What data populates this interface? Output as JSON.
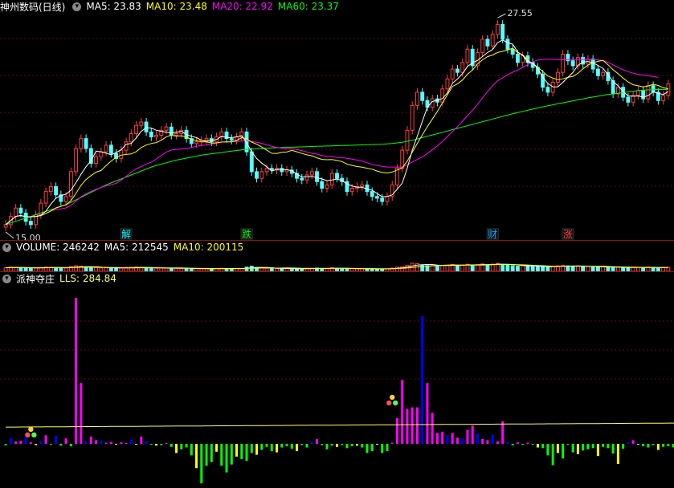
{
  "price_panel": {
    "name": "神州数码(日线)",
    "ma5": "MA5: 23.83",
    "ma10": "MA10: 23.48",
    "ma20": "MA20: 22.92",
    "ma60": "MA60: 23.37",
    "colors": {
      "name": "#ffffff",
      "ma5": "#ffffff",
      "ma10": "#ffff00",
      "ma20": "#ff00ff",
      "ma60": "#00ff00"
    }
  },
  "volume_panel": {
    "label": "VOLUME: 246242",
    "ma5": "MA5: 212545",
    "ma10": "MA10: 200115"
  },
  "indicator_panel": {
    "name": "派神夺庄",
    "lls": "LLS: 284.84"
  },
  "events": [
    {
      "label": "解",
      "index": 24,
      "color": "#00ffff"
    },
    {
      "label": "跌",
      "index": 48,
      "color": "#00ff00"
    },
    {
      "label": "财",
      "index": 97,
      "color": "#00aaff"
    },
    {
      "label": "涨",
      "index": 112,
      "color": "#ff4040"
    }
  ],
  "chart_data": [
    {
      "type": "candlestick",
      "title": "神州数码(日线)",
      "ylim": [
        15.0,
        27.9
      ],
      "high_annotation": "27.55",
      "low_annotation": "15.00",
      "closes": [
        15.2,
        15.7,
        16.2,
        15.9,
        15.4,
        15.2,
        15.8,
        16.5,
        17.2,
        17.5,
        17.0,
        16.6,
        16.9,
        18.4,
        19.8,
        20.4,
        19.8,
        18.9,
        19.3,
        19.6,
        20.0,
        19.5,
        19.2,
        19.7,
        20.2,
        20.7,
        21.2,
        21.4,
        20.8,
        20.5,
        20.6,
        20.9,
        21.1,
        20.6,
        20.7,
        20.9,
        20.4,
        20.1,
        20.2,
        20.3,
        20.4,
        20.2,
        20.5,
        20.8,
        20.4,
        20.3,
        20.5,
        20.8,
        19.6,
        18.4,
        18.0,
        18.4,
        18.6,
        18.5,
        18.6,
        18.4,
        18.5,
        18.3,
        18.0,
        17.9,
        18.2,
        18.4,
        17.8,
        17.4,
        17.6,
        18.3,
        18.0,
        17.8,
        17.2,
        17.4,
        17.5,
        17.6,
        17.2,
        16.9,
        16.8,
        16.6,
        16.9,
        17.6,
        18.6,
        19.7,
        20.9,
        22.4,
        23.2,
        22.7,
        22.3,
        22.8,
        22.6,
        23.4,
        24.0,
        24.6,
        24.4,
        25.0,
        25.8,
        24.8,
        25.6,
        26.4,
        26.0,
        26.7,
        27.3,
        26.4,
        25.8,
        25.5,
        25.0,
        25.4,
        25.0,
        24.7,
        24.3,
        23.5,
        23.2,
        23.8,
        24.4,
        25.5,
        25.1,
        24.8,
        25.3,
        24.9,
        25.2,
        24.6,
        24.2,
        24.4,
        23.9,
        23.1,
        23.5,
        22.9,
        22.6,
        23.0,
        23.3,
        22.8,
        23.6,
        23.2,
        22.7,
        23.0,
        23.7
      ],
      "ma5": [
        15.2,
        15.45,
        15.7,
        15.75,
        15.68,
        15.68,
        15.7,
        15.76,
        16.02,
        16.44,
        16.8,
        16.96,
        17.04,
        17.28,
        17.74,
        18.24,
        18.7,
        19.06,
        19.64,
        19.6,
        19.52,
        19.42,
        19.56,
        19.72,
        20.06,
        20.1,
        20.44,
        20.84,
        21.06,
        21.04,
        20.9,
        20.84,
        20.78,
        20.74,
        20.78,
        20.84,
        20.64,
        20.54,
        20.46,
        20.3,
        20.24,
        20.28,
        20.34,
        20.54,
        20.46,
        20.46,
        20.5,
        20.58,
        20.16,
        19.6,
        19.2,
        18.92,
        18.7,
        18.44,
        18.54,
        18.54,
        18.52,
        18.46,
        18.26,
        18.08,
        18.1,
        18.12,
        18.04,
        17.96,
        17.86,
        17.9,
        17.96,
        17.86,
        17.66,
        17.54,
        17.46,
        17.46,
        17.34,
        17.28,
        17.08,
        16.88,
        16.9,
        17.0,
        17.34,
        17.7,
        18.62,
        19.7,
        20.56,
        21.44,
        22.3,
        22.64,
        22.72,
        22.82,
        23.16,
        23.74,
        24.0,
        24.32,
        24.76,
        24.98,
        25.12,
        25.36,
        25.6,
        25.78,
        26.2,
        26.36,
        26.2,
        26.1,
        25.64,
        25.42,
        25.02,
        24.96,
        24.64,
        24.1,
        23.74,
        23.52,
        23.52,
        23.8,
        24.1,
        24.4,
        24.82,
        25.02,
        25.06,
        24.98,
        24.82,
        24.64,
        24.26,
        23.84,
        23.6,
        23.24,
        22.98,
        22.96,
        22.98,
        22.9,
        23.0,
        23.22,
        23.14,
        23.06,
        23.24
      ],
      "ma10": [
        15.2,
        15.45,
        15.7,
        15.75,
        15.68,
        15.67,
        15.69,
        15.74,
        15.88,
        16.03,
        16.21,
        16.31,
        16.4,
        16.65,
        17.09,
        17.57,
        17.93,
        18.16,
        18.37,
        18.47,
        18.77,
        19.04,
        19.27,
        19.4,
        19.44,
        19.47,
        19.61,
        19.86,
        20.01,
        20.1,
        20.16,
        20.3,
        20.51,
        20.6,
        20.55,
        20.57,
        20.49,
        20.36,
        20.27,
        20.21,
        20.2,
        20.13,
        20.14,
        20.19,
        20.2,
        20.2,
        20.28,
        20.46,
        20.39,
        20.19,
        20.06,
        19.89,
        19.7,
        19.51,
        19.5,
        19.57,
        19.59,
        19.69,
        19.6,
        19.5,
        19.42,
        19.36,
        19.24,
        19.14,
        19.12,
        19.13,
        19.08,
        19.01,
        18.86,
        18.78,
        18.71,
        18.67,
        18.61,
        18.55,
        18.44,
        18.35,
        18.32,
        18.38,
        18.5,
        18.63,
        19.04,
        19.58,
        20.11,
        20.62,
        21.12,
        21.58,
        22.04,
        22.55,
        23.05,
        23.55,
        23.71,
        23.94,
        24.29,
        24.54,
        24.91,
        25.16,
        25.35,
        25.45,
        25.6,
        25.67,
        25.76,
        25.86,
        25.59,
        25.46,
        25.12,
        24.94,
        24.71,
        24.45,
        24.18,
        24.06,
        23.95,
        24.01,
        24.1,
        24.16,
        24.34,
        24.61,
        24.84,
        24.98,
        25.07,
        25.12,
        24.86,
        24.56,
        24.32,
        24.06,
        23.82,
        23.65,
        23.59,
        23.52,
        23.58,
        23.68,
        23.61,
        23.47,
        23.41
      ],
      "ma20": [
        15.2,
        15.45,
        15.7,
        15.75,
        15.68,
        15.67,
        15.69,
        15.74,
        15.88,
        16.03,
        16.11,
        16.15,
        16.21,
        16.36,
        16.62,
        16.88,
        17.07,
        17.2,
        17.33,
        17.45,
        17.54,
        17.61,
        17.7,
        17.88,
        18.12,
        18.37,
        18.56,
        18.71,
        18.86,
        18.97,
        19.17,
        19.38,
        19.59,
        19.71,
        19.75,
        19.77,
        19.79,
        19.87,
        19.93,
        19.99,
        20.01,
        20.06,
        20.13,
        20.19,
        20.21,
        20.22,
        20.23,
        20.25,
        20.27,
        20.23,
        20.18,
        20.11,
        20.02,
        19.93,
        19.87,
        19.82,
        19.79,
        19.78,
        19.74,
        19.67,
        19.59,
        19.51,
        19.46,
        19.38,
        19.33,
        19.3,
        19.26,
        19.25,
        19.21,
        19.16,
        19.1,
        19.05,
        18.94,
        18.84,
        18.77,
        18.72,
        18.68,
        18.68,
        18.68,
        18.68,
        18.81,
        18.98,
        19.14,
        19.29,
        19.5,
        19.72,
        19.96,
        20.23,
        20.53,
        20.82,
        21.12,
        21.45,
        21.79,
        22.11,
        22.46,
        22.86,
        23.24,
        23.59,
        23.89,
        24.07,
        24.25,
        24.41,
        24.54,
        24.7,
        24.87,
        25.03,
        25.15,
        25.18,
        25.2,
        25.19,
        25.18,
        25.16,
        25.17,
        25.17,
        25.16,
        25.18,
        25.19,
        25.17,
        25.15,
        25.11,
        25.01,
        24.85,
        24.7,
        24.56,
        24.44,
        24.35,
        24.28,
        24.24,
        24.2,
        24.15,
        24.1
      ],
      "ma60": [
        15.2,
        15.3,
        15.4,
        15.5,
        15.6,
        15.7,
        15.8,
        15.9,
        16.0,
        16.1,
        16.2,
        16.3,
        16.4,
        16.55,
        16.7,
        16.85,
        17.0,
        17.15,
        17.3,
        17.45,
        17.6,
        17.72,
        17.84,
        17.96,
        18.08,
        18.2,
        18.32,
        18.44,
        18.56,
        18.68,
        18.78,
        18.86,
        18.94,
        19.02,
        19.1,
        19.16,
        19.22,
        19.28,
        19.34,
        19.4,
        19.44,
        19.48,
        19.52,
        19.56,
        19.6,
        19.64,
        19.68,
        19.72,
        19.74,
        19.76,
        19.78,
        19.8,
        19.82,
        19.84,
        19.85,
        19.86,
        19.87,
        19.88,
        19.89,
        19.9,
        19.91,
        19.92,
        19.93,
        19.94,
        19.95,
        19.96,
        19.97,
        19.98,
        19.99,
        20.0,
        20.01,
        20.02,
        20.03,
        20.04,
        20.05,
        20.06,
        20.08,
        20.1,
        20.14,
        20.18,
        20.24,
        20.3,
        20.38,
        20.46,
        20.54,
        20.62,
        20.7,
        20.78,
        20.86,
        20.94,
        21.02,
        21.1,
        21.18,
        21.26,
        21.34,
        21.42,
        21.5,
        21.58,
        21.66,
        21.74,
        21.82,
        21.9,
        21.97,
        22.04,
        22.11,
        22.18,
        22.25,
        22.32,
        22.38,
        22.44,
        22.5,
        22.56,
        22.62,
        22.68,
        22.74,
        22.8,
        22.86,
        22.91,
        22.96,
        23.01,
        23.06,
        23.1,
        23.14,
        23.18,
        23.22,
        23.26,
        23.3,
        23.32,
        23.34,
        23.35,
        23.36,
        23.37,
        23.37
      ]
    },
    {
      "type": "bar",
      "title": "VOLUME",
      "ylim": [
        0,
        1000000
      ],
      "values": [
        220000,
        260000,
        240000,
        230000,
        200000,
        190000,
        210000,
        240000,
        270000,
        250000,
        230000,
        210000,
        200000,
        300000,
        350000,
        320000,
        260000,
        230000,
        240000,
        210000,
        230000,
        210000,
        190000,
        200000,
        250000,
        260000,
        270000,
        240000,
        210000,
        200000,
        190000,
        200000,
        210000,
        190000,
        180000,
        190000,
        170000,
        160000,
        170000,
        160000,
        170000,
        160000,
        180000,
        190000,
        170000,
        160000,
        170000,
        180000,
        260000,
        320000,
        240000,
        200000,
        190000,
        180000,
        170000,
        160000,
        170000,
        160000,
        150000,
        170000,
        180000,
        190000,
        200000,
        170000,
        160000,
        220000,
        190000,
        170000,
        180000,
        160000,
        150000,
        170000,
        160000,
        150000,
        140000,
        130000,
        150000,
        200000,
        260000,
        300000,
        380000,
        500000,
        480000,
        400000,
        360000,
        380000,
        320000,
        360000,
        380000,
        420000,
        360000,
        400000,
        440000,
        380000,
        420000,
        460000,
        400000,
        450000,
        500000,
        420000,
        380000,
        350000,
        320000,
        340000,
        310000,
        290000,
        300000,
        280000,
        260000,
        300000,
        340000,
        380000,
        340000,
        300000,
        320000,
        290000,
        300000,
        280000,
        260000,
        270000,
        250000,
        240000,
        260000,
        230000,
        220000,
        240000,
        250000,
        220000,
        260000,
        240000,
        220000,
        230000,
        246242
      ],
      "ma5": [
        220000,
        240000,
        240000,
        237500,
        230000,
        224000,
        214000,
        214000,
        222000,
        232000,
        240000,
        242000,
        232000,
        238000,
        262000,
        276000,
        286000,
        292000,
        280000,
        260000,
        242000,
        226000,
        216000,
        208000,
        216000,
        222000,
        234000,
        244000,
        246000,
        236000,
        222000,
        208000,
        200000,
        198000,
        194000,
        192000,
        188000,
        178000,
        174000,
        168000,
        166000,
        164000,
        166000,
        172000,
        174000,
        172000,
        174000,
        174000,
        188000,
        218000,
        234000,
        244000,
        242000,
        226000,
        196000,
        180000,
        174000,
        168000,
        164000,
        162000,
        166000,
        170000,
        178000,
        182000,
        180000,
        188000,
        188000,
        190000,
        184000,
        178000,
        170000,
        166000,
        164000,
        158000,
        154000,
        148000,
        150000,
        164000,
        188000,
        218000,
        258000,
        328000,
        384000,
        412000,
        424000,
        424000,
        388000,
        364000,
        360000,
        372000,
        368000,
        376000,
        400000,
        400000,
        400000,
        420000,
        420000,
        422000,
        446000,
        446000,
        434000,
        424000,
        398000,
        366000,
        344000,
        322000,
        312000,
        302000,
        290000,
        286000,
        296000,
        312000,
        324000,
        332000,
        336000,
        326000,
        310000,
        298000,
        290000,
        280000,
        272000,
        260000,
        254000,
        250000,
        242000,
        238000,
        240000,
        234000,
        236000,
        240000,
        236000,
        234000,
        235000
      ],
      "ma10": [
        220000,
        240000,
        240000,
        237500,
        230000,
        224000,
        220000,
        222000,
        226000,
        228000,
        228000,
        228000,
        224000,
        230000,
        242000,
        250000,
        254000,
        253000,
        250000,
        246000,
        242000,
        239000,
        236000,
        226000,
        216000,
        210000,
        214000,
        218000,
        223000,
        222000,
        218000,
        215000,
        213000,
        212000,
        212000,
        208000,
        202000,
        193000,
        188000,
        182000,
        178000,
        175000,
        172000,
        172000,
        171000,
        169000,
        169000,
        170000,
        180000,
        195000,
        202000,
        207000,
        208000,
        203000,
        201000,
        205000,
        208000,
        205000,
        198000,
        190000,
        183000,
        180000,
        182000,
        181000,
        178000,
        182000,
        184000,
        184000,
        182000,
        178000,
        174000,
        172000,
        171000,
        170000,
        167000,
        163000,
        163000,
        165000,
        173000,
        183000,
        204000,
        239000,
        269000,
        290000,
        312000,
        334000,
        355000,
        373000,
        387000,
        398000,
        396000,
        386000,
        382000,
        382000,
        384000,
        392000,
        398000,
        413000,
        423000,
        423000,
        423000,
        422000,
        410000,
        404000,
        394000,
        377000,
        367000,
        350000,
        328000,
        316000,
        309000,
        307000,
        309000,
        309000,
        311000,
        311000,
        311000,
        311000,
        311000,
        308000,
        299000,
        285000,
        276000,
        269000,
        260000,
        255000,
        250000,
        244000,
        243000,
        240000,
        237000,
        236000,
        236000
      ]
    },
    {
      "type": "bar",
      "title": "派神夺庄",
      "ylim": [
        -140,
        520
      ],
      "lls_line_value": 284.84,
      "values": [
        -5,
        18,
        8,
        10,
        22,
        5,
        -4,
        9,
        28,
        -2,
        26,
        -6,
        18,
        -8,
        480,
        200,
        8,
        24,
        12,
        10,
        4,
        6,
        -3,
        5,
        3,
        14,
        -3,
        24,
        8,
        -2,
        -6,
        -4,
        3,
        -10,
        -30,
        -18,
        -12,
        -38,
        -80,
        -130,
        -72,
        -60,
        -26,
        -72,
        -94,
        -68,
        -42,
        -50,
        -56,
        -30,
        -36,
        -20,
        -10,
        -24,
        -28,
        -12,
        -8,
        -16,
        -24,
        -4,
        -12,
        6,
        16,
        -4,
        -18,
        -6,
        -10,
        -4,
        -14,
        -8,
        -6,
        -12,
        -30,
        -24,
        -2,
        -30,
        -24,
        4,
        85,
        210,
        115,
        120,
        120,
        420,
        200,
        102,
        36,
        40,
        28,
        36,
        20,
        18,
        46,
        60,
        34,
        16,
        12,
        30,
        8,
        74,
        6,
        -5,
        5,
        -3,
        4,
        -2,
        -12,
        -14,
        -38,
        -70,
        -30,
        -48,
        -2,
        -28,
        -34,
        -22,
        -18,
        -14,
        -40,
        -10,
        -14,
        -32,
        -66,
        -16,
        6,
        12,
        -2,
        -8,
        -12,
        -4,
        -20,
        -10,
        -8,
        -12,
        -18,
        -30,
        -14
      ],
      "colors": {
        "positive": "#ff00ff",
        "positive_alt": "#0000ff",
        "negative": "#00ff00",
        "negative_alt": "#ffff00",
        "lls": "#ffff66"
      }
    }
  ]
}
